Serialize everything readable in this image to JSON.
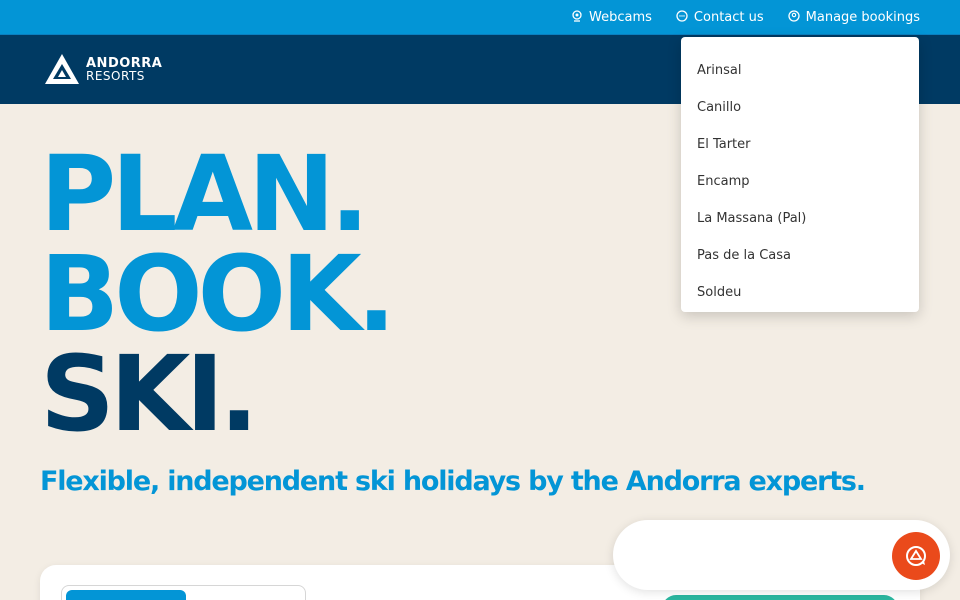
{
  "topbar": {
    "webcams_label": "Webcams",
    "contact_label": "Contact us",
    "manage_label": "Manage bookings"
  },
  "logo": {
    "line1": "ANDORRA",
    "line2": "RESORTS"
  },
  "hero": {
    "line1": "PLAN.",
    "line2": "BOOK.",
    "line3": "SKI.",
    "tagline": "Flexible, independent ski holidays by the Andorra experts."
  },
  "dropdown": {
    "items": [
      "Arinsal",
      "Canillo",
      "El Tarter",
      "Encamp",
      "La Massana (Pal)",
      "Pas de la Casa",
      "Soldeu"
    ]
  },
  "colors": {
    "topbar": "#0395d6",
    "navbar": "#003a63",
    "hero_blue": "#0395d6",
    "hero_dark": "#003a63",
    "page_bg": "#f3ede4",
    "chat": "#ea4a1b",
    "cta_green": "#2bb7a0"
  },
  "icons": {
    "webcams": "webcam-icon",
    "contact": "chat-bubble-icon",
    "manage": "user-circle-icon",
    "chat": "chat-launcher-icon"
  }
}
